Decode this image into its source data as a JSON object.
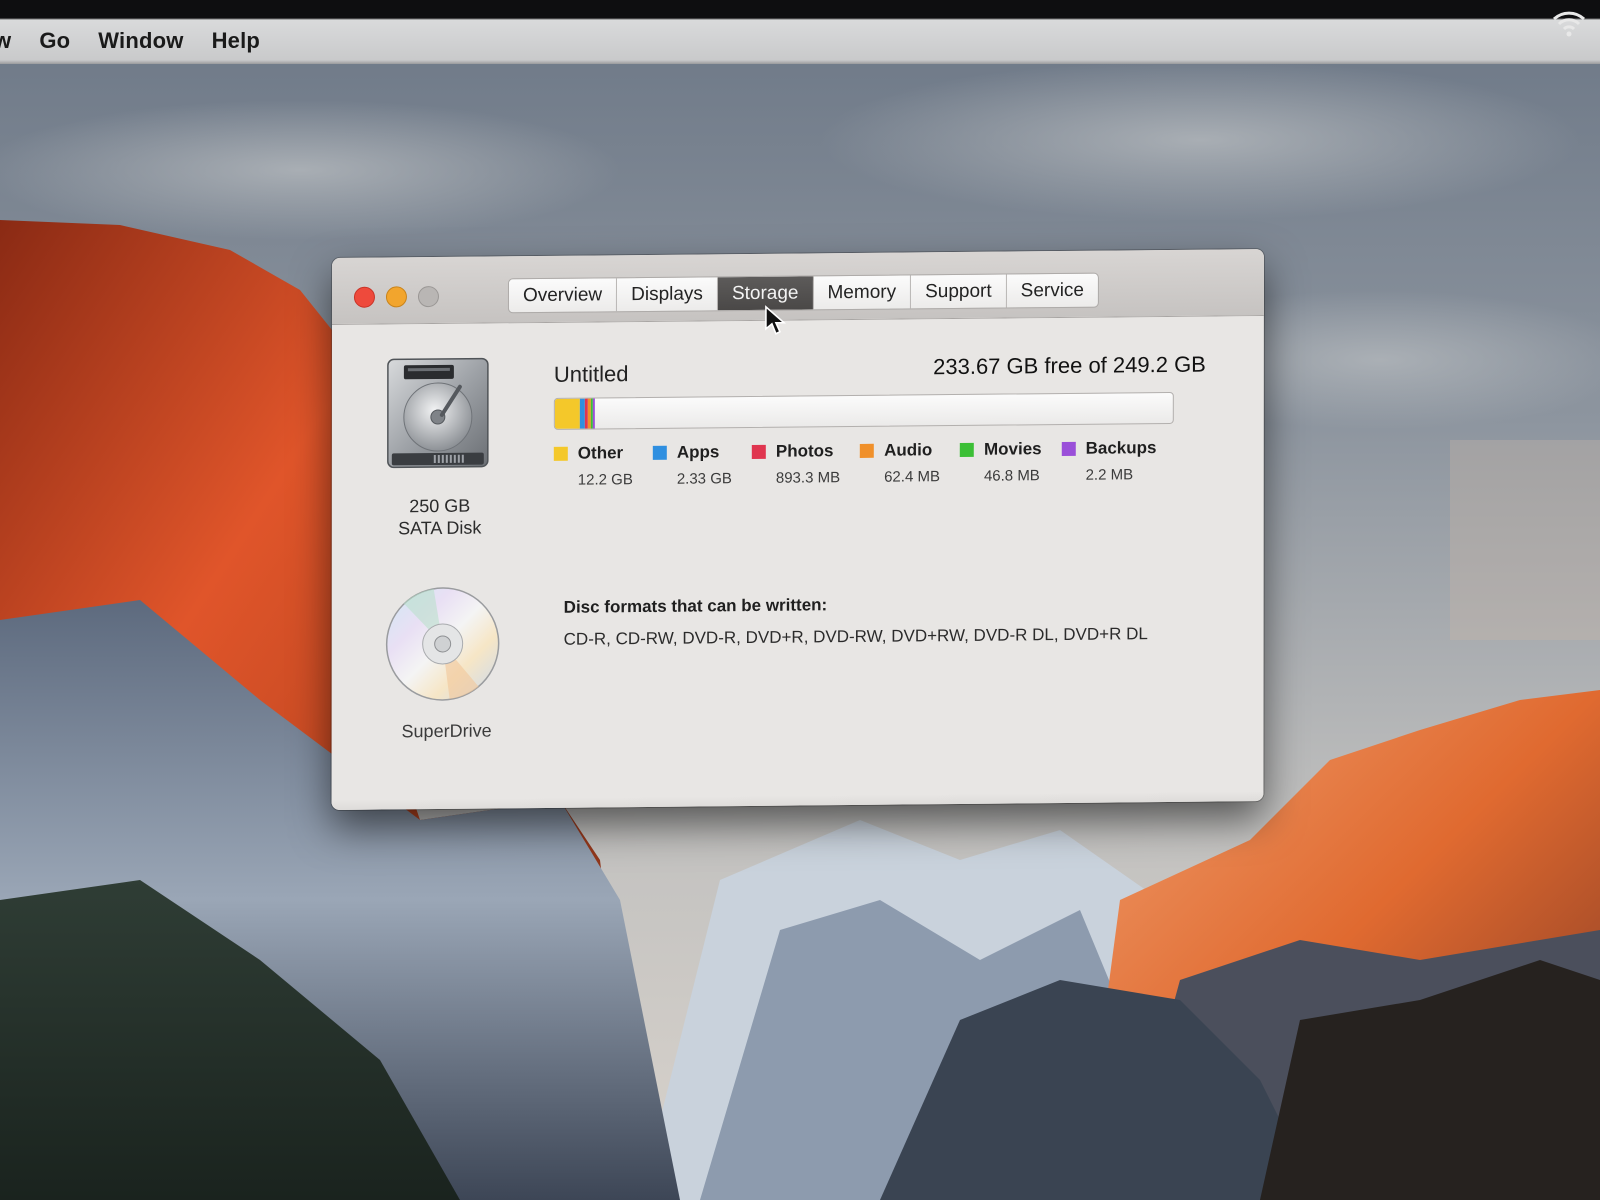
{
  "menubar": {
    "items": [
      "w",
      "Go",
      "Window",
      "Help"
    ]
  },
  "window": {
    "tabs": [
      "Overview",
      "Displays",
      "Storage",
      "Memory",
      "Support",
      "Service"
    ],
    "active_tab": "Storage",
    "disk": {
      "size_line1": "250 GB",
      "size_line2": "SATA Disk",
      "volume_name": "Untitled",
      "free_text": "233.67 GB free of 249.2 GB"
    },
    "usage": [
      {
        "name": "Other",
        "value": "12.2 GB",
        "color": "#f4c82a"
      },
      {
        "name": "Apps",
        "value": "2.33 GB",
        "color": "#2f8fe0"
      },
      {
        "name": "Photos",
        "value": "893.3 MB",
        "color": "#e0354f"
      },
      {
        "name": "Audio",
        "value": "62.4 MB",
        "color": "#f0902a"
      },
      {
        "name": "Movies",
        "value": "46.8 MB",
        "color": "#3cbf36"
      },
      {
        "name": "Backups",
        "value": "2.2 MB",
        "color": "#9a4fd9"
      }
    ],
    "superdrive": {
      "name": "SuperDrive",
      "formats_title": "Disc formats that can be written:",
      "formats": "CD-R, CD-RW, DVD-R, DVD+R, DVD-RW, DVD+RW, DVD-R DL, DVD+R DL"
    }
  }
}
